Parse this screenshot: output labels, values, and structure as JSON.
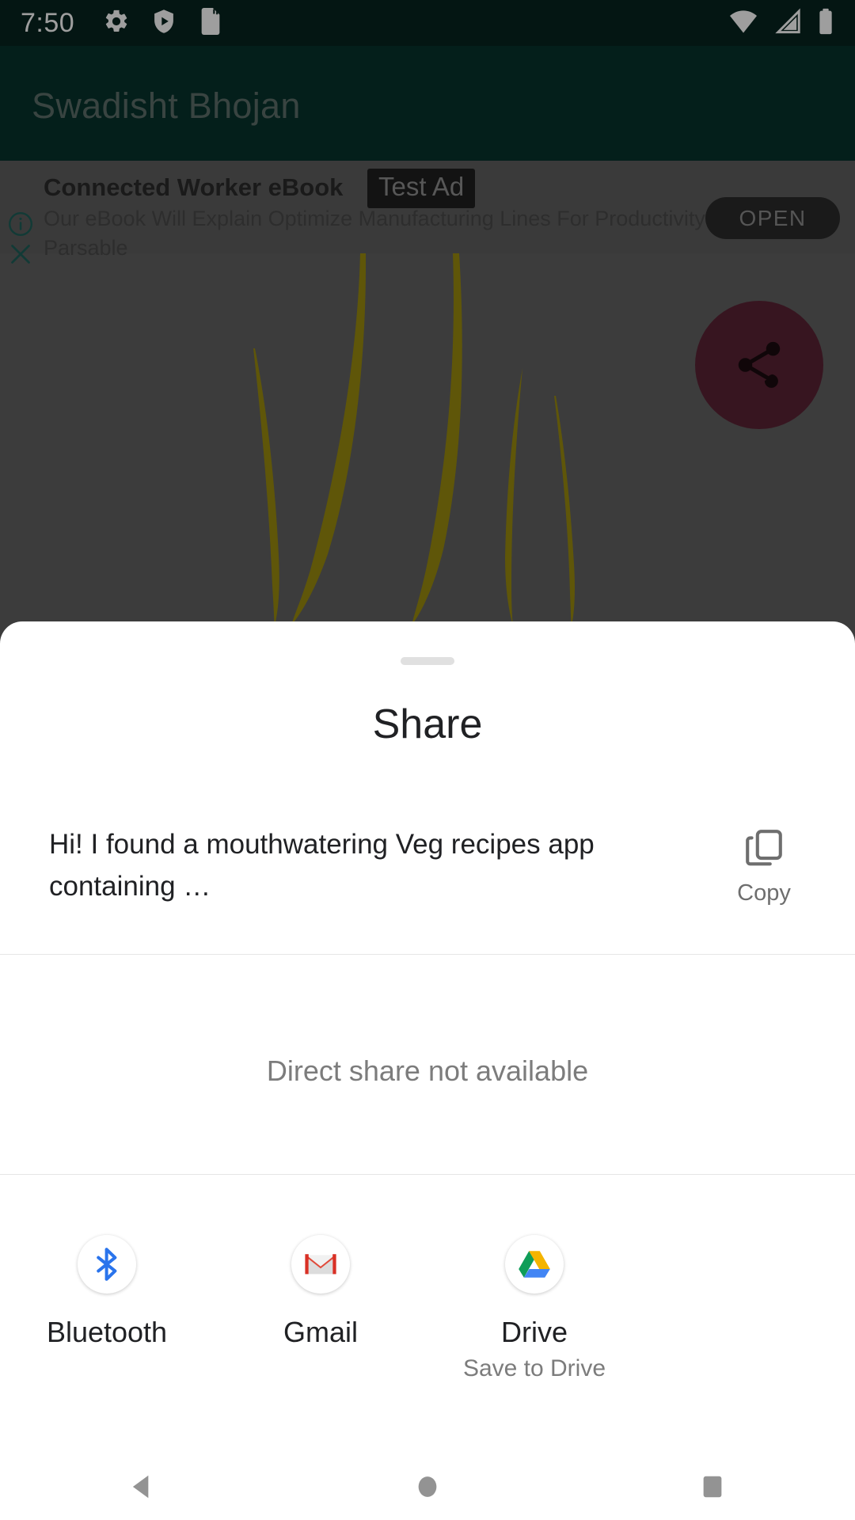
{
  "status_bar": {
    "time": "7:50",
    "left_icons": [
      "settings-gear-icon",
      "play-protect-shield-icon",
      "sd-card-icon"
    ],
    "right_icons": [
      "wifi-icon",
      "cellular-signal-icon",
      "battery-full-icon"
    ]
  },
  "app": {
    "title": "Swadisht Bhojan",
    "header_color": "#07332c",
    "fab": {
      "icon": "share-icon",
      "color": "#5a2334"
    }
  },
  "ad": {
    "headline": "Connected Worker eBook",
    "badge": "Test Ad",
    "body": "Our eBook Will Explain Optimize Manufacturing Lines For Productivity",
    "advertiser": "Parsable",
    "cta_label": "OPEN",
    "info_icon": "info-icon",
    "close_icon": "close-icon"
  },
  "share_sheet": {
    "title": "Share",
    "message": "Hi! I found a mouthwatering Veg recipes app containing …",
    "copy": {
      "label": "Copy",
      "icon": "copy-icon"
    },
    "direct_share_status": "Direct share not available",
    "targets": [
      {
        "label": "Bluetooth",
        "sublabel": "",
        "icon": "bluetooth-icon"
      },
      {
        "label": "Gmail",
        "sublabel": "",
        "icon": "gmail-icon"
      },
      {
        "label": "Drive",
        "sublabel": "Save to Drive",
        "icon": "google-drive-icon"
      }
    ]
  },
  "nav_bar": {
    "back_label": "back-button",
    "home_label": "home-button",
    "recents_label": "recents-button"
  }
}
